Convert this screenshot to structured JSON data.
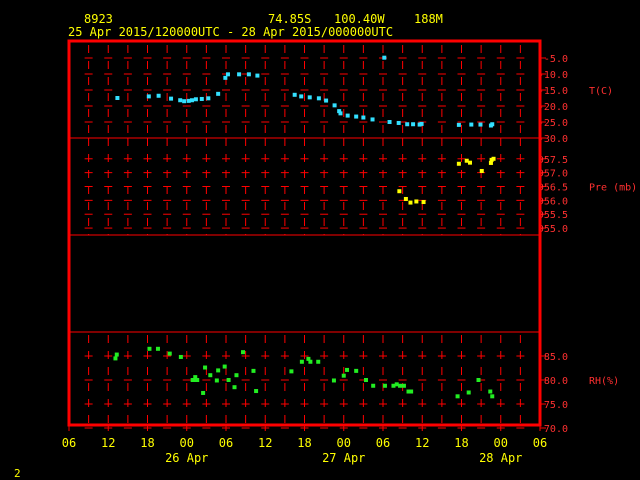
{
  "header": {
    "station": "8923",
    "lat": "74.85S",
    "lon": "100.40W",
    "elev": "188M",
    "range": "25 Apr 2015/120000UTC - 28 Apr 2015/000000UTC"
  },
  "page_number": "2",
  "colors": {
    "frame": "#ff0000",
    "grid": "#ff0000",
    "temperature": "#33e0ff",
    "pressure": "#ffff00",
    "rh": "#22ee22",
    "text": "#ffff00",
    "axis_labels": "#ff3030",
    "background": "#000000"
  },
  "chart_data": {
    "type": "scatter",
    "x_axis": {
      "unit": "hours since 25 Apr 06 UTC",
      "range": [
        0,
        72
      ],
      "tick_labels": [
        "06",
        "12",
        "18",
        "00",
        "06",
        "12",
        "18",
        "00",
        "06",
        "12",
        "18",
        "00",
        "06"
      ],
      "date_labels": [
        {
          "at": "00",
          "text": "26 Apr"
        },
        {
          "at": "00",
          "text": "27 Apr"
        },
        {
          "at": "00",
          "text": "28 Apr"
        }
      ]
    },
    "grid": true,
    "panels": [
      {
        "name": "T(C)",
        "label": "T(C)",
        "ylim": [
          -30,
          0
        ],
        "ticks": [
          "-5.0",
          "-10.0",
          "-15.0",
          "-20.0",
          "-25.0",
          "-30.0"
        ],
        "tick_values": [
          -5,
          -10,
          -15,
          -20,
          -25,
          -30
        ],
        "points": [
          [
            7.4,
            -17.5
          ],
          [
            12.2,
            -17.0
          ],
          [
            13.7,
            -16.8
          ],
          [
            15.6,
            -17.7
          ],
          [
            17.0,
            -18.2
          ],
          [
            17.6,
            -18.5
          ],
          [
            18.3,
            -18.4
          ],
          [
            18.8,
            -18.2
          ],
          [
            19.4,
            -17.9
          ],
          [
            20.3,
            -17.8
          ],
          [
            21.3,
            -17.6
          ],
          [
            22.8,
            -16.2
          ],
          [
            23.9,
            -11.2
          ],
          [
            24.3,
            -10.1
          ],
          [
            26.0,
            -10.1
          ],
          [
            27.5,
            -10.1
          ],
          [
            28.8,
            -10.5
          ],
          [
            34.5,
            -16.5
          ],
          [
            35.5,
            -17.0
          ],
          [
            36.8,
            -17.3
          ],
          [
            38.2,
            -17.6
          ],
          [
            39.3,
            -18.3
          ],
          [
            40.6,
            -19.8
          ],
          [
            41.3,
            -21.6
          ],
          [
            41.5,
            -22.3
          ],
          [
            42.6,
            -23.0
          ],
          [
            43.9,
            -23.3
          ],
          [
            45.0,
            -23.6
          ],
          [
            46.4,
            -24.2
          ],
          [
            48.2,
            -4.9
          ],
          [
            49.0,
            -25.0
          ],
          [
            50.4,
            -25.3
          ],
          [
            51.7,
            -25.7
          ],
          [
            52.6,
            -25.7
          ],
          [
            53.6,
            -25.8
          ],
          [
            53.9,
            -25.6
          ],
          [
            59.6,
            -25.9
          ],
          [
            61.5,
            -25.8
          ],
          [
            62.9,
            -25.8
          ],
          [
            64.5,
            -26.1
          ],
          [
            64.7,
            -25.7
          ]
        ]
      },
      {
        "name": "Pre (mb)",
        "label": "Pre (mb)",
        "ylim": [
          954.75,
          958.25
        ],
        "ticks": [
          "957.5",
          "957.0",
          "956.5",
          "956.0",
          "955.5",
          "955.0"
        ],
        "tick_values": [
          957.5,
          957.0,
          956.5,
          956.0,
          955.5,
          955.0
        ],
        "points": [
          [
            50.5,
            956.33
          ],
          [
            51.5,
            956.05
          ],
          [
            52.2,
            955.92
          ],
          [
            53.1,
            955.96
          ],
          [
            54.2,
            955.94
          ],
          [
            59.6,
            957.32
          ],
          [
            60.8,
            957.43
          ],
          [
            61.3,
            957.36
          ],
          [
            63.1,
            957.06
          ],
          [
            64.5,
            957.35
          ],
          [
            64.6,
            957.46
          ],
          [
            64.9,
            957.5
          ]
        ]
      },
      {
        "name": "RH(%)",
        "label": "RH(%)",
        "ylim": [
          70,
          90
        ],
        "ticks": [
          "85.0",
          "80.0",
          "75.0",
          "70.0"
        ],
        "tick_values": [
          85,
          80,
          75,
          70
        ],
        "points": [
          [
            7.1,
            84.5
          ],
          [
            7.3,
            85.3
          ],
          [
            12.3,
            86.5
          ],
          [
            13.6,
            86.5
          ],
          [
            15.4,
            85.5
          ],
          [
            17.1,
            84.8
          ],
          [
            18.9,
            80.0
          ],
          [
            19.1,
            80.0
          ],
          [
            19.3,
            80.6
          ],
          [
            19.6,
            80.0
          ],
          [
            20.5,
            77.3
          ],
          [
            20.8,
            82.6
          ],
          [
            21.6,
            81.0
          ],
          [
            22.6,
            79.9
          ],
          [
            22.8,
            82.0
          ],
          [
            23.8,
            82.8
          ],
          [
            24.4,
            80.0
          ],
          [
            25.3,
            78.5
          ],
          [
            25.6,
            81.0
          ],
          [
            26.6,
            85.8
          ],
          [
            28.2,
            81.9
          ],
          [
            28.6,
            77.7
          ],
          [
            34.0,
            81.8
          ],
          [
            35.6,
            83.8
          ],
          [
            36.6,
            84.4
          ],
          [
            36.9,
            83.8
          ],
          [
            38.1,
            83.8
          ],
          [
            40.5,
            79.9
          ],
          [
            42.0,
            80.9
          ],
          [
            42.5,
            82.1
          ],
          [
            43.9,
            81.9
          ],
          [
            45.4,
            80.0
          ],
          [
            46.5,
            78.8
          ],
          [
            48.3,
            78.8
          ],
          [
            49.6,
            78.8
          ],
          [
            50.1,
            79.1
          ],
          [
            50.6,
            78.8
          ],
          [
            51.2,
            78.8
          ],
          [
            51.9,
            77.6
          ],
          [
            52.3,
            77.6
          ],
          [
            59.4,
            76.6
          ],
          [
            61.1,
            77.4
          ],
          [
            62.6,
            80.0
          ],
          [
            64.4,
            77.6
          ],
          [
            64.7,
            76.6
          ]
        ]
      }
    ]
  }
}
